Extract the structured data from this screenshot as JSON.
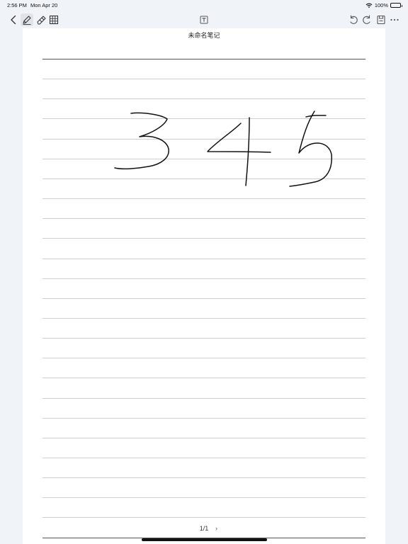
{
  "status": {
    "time": "2:56 PM",
    "date": "Mon Apr 20",
    "battery": "100%",
    "battery_level": 1.0
  },
  "toolbar": {
    "left_tools": [
      {
        "name": "back-icon"
      },
      {
        "name": "pen-icon",
        "active": true
      },
      {
        "name": "eraser-icon"
      },
      {
        "name": "grid-icon"
      }
    ],
    "center_tool": {
      "name": "text-box-icon"
    },
    "right_tools": [
      {
        "name": "undo-icon"
      },
      {
        "name": "redo-icon"
      },
      {
        "name": "save-icon"
      },
      {
        "name": "more-icon"
      }
    ]
  },
  "note": {
    "title": "未命名笔记",
    "handwriting": "345",
    "ink_color": "#111111"
  },
  "pager": {
    "label": "1/1",
    "next": "›"
  }
}
